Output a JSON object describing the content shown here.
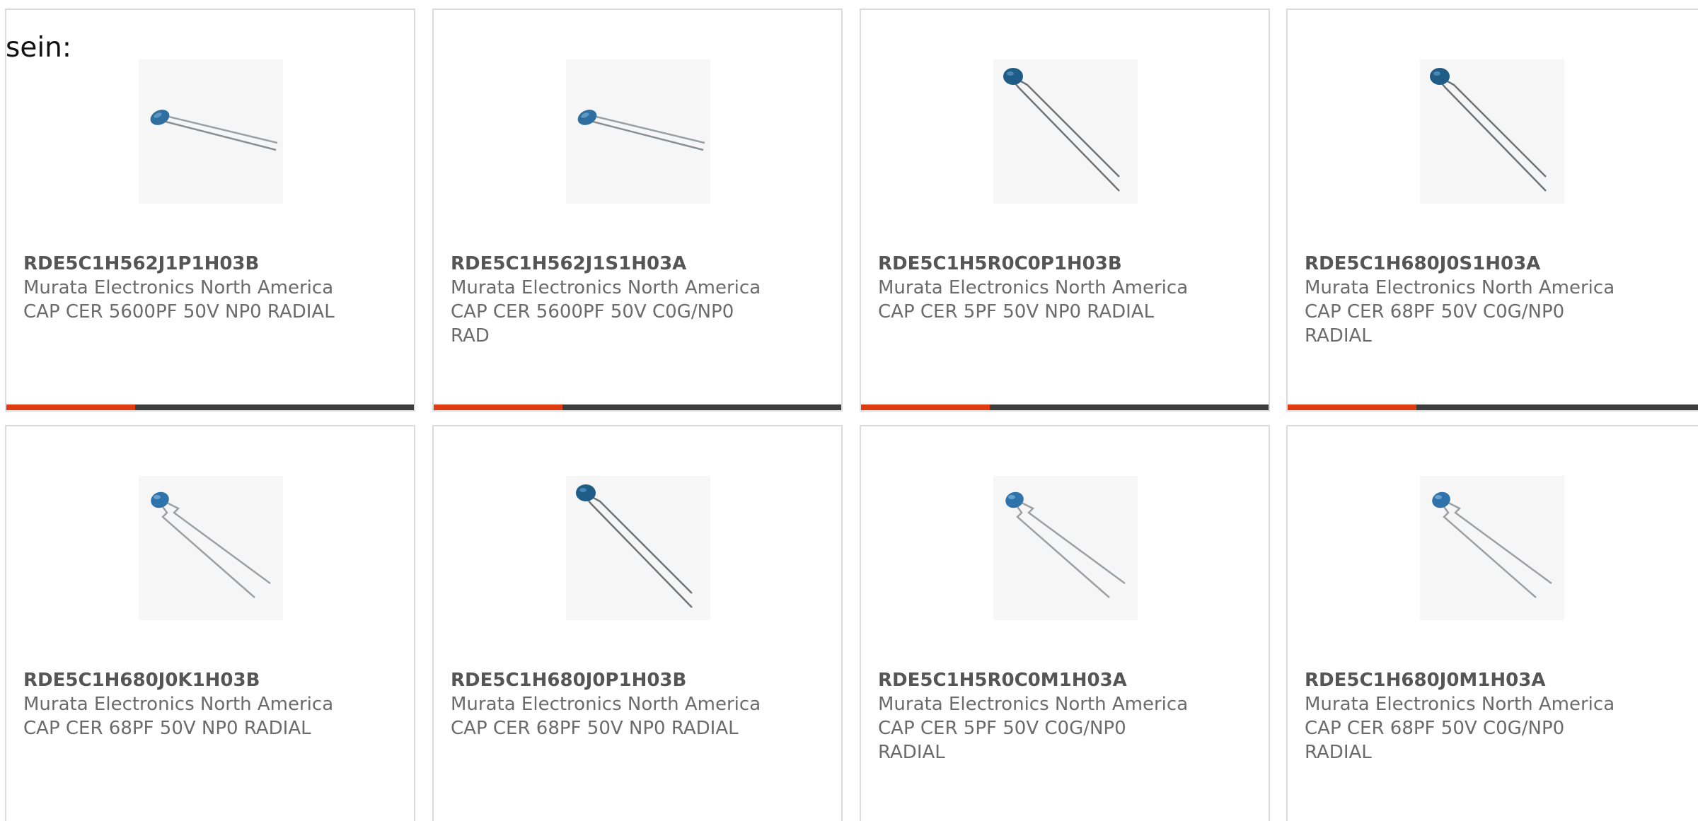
{
  "lead_text": "sein:",
  "colors": {
    "accent": "#e03c12",
    "bar_dark": "#3d3d3d",
    "card_border": "#dcdcdc",
    "capacitor_blue": "#2e6f9f",
    "lead_gray": "#8a8f93"
  },
  "products": [
    {
      "part_number": "RDE5C1H562J1P1H03B",
      "manufacturer": "Murata Electronics North America",
      "description": "CAP CER 5600PF 50V NP0 RADIAL",
      "image_icon": "capacitor-horizontal-image"
    },
    {
      "part_number": "RDE5C1H562J1S1H03A",
      "manufacturer": "Murata Electronics North America",
      "description": "CAP CER 5600PF 50V C0G/NP0 RAD",
      "image_icon": "capacitor-horizontal-image"
    },
    {
      "part_number": "RDE5C1H5R0C0P1H03B",
      "manufacturer": "Murata Electronics North America",
      "description": "CAP CER 5PF 50V NP0 RADIAL",
      "image_icon": "capacitor-diagonal-image"
    },
    {
      "part_number": "RDE5C1H680J0S1H03A",
      "manufacturer": "Murata Electronics North America",
      "description": "CAP CER 68PF 50V C0G/NP0 RADIAL",
      "image_icon": "capacitor-diagonal-image"
    },
    {
      "part_number": "RDE5C1H680J0K1H03B",
      "manufacturer": "Murata Electronics North America",
      "description": "CAP CER 68PF 50V NP0 RADIAL",
      "image_icon": "capacitor-kinked-leads-image"
    },
    {
      "part_number": "RDE5C1H680J0P1H03B",
      "manufacturer": "Murata Electronics North America",
      "description": "CAP CER 68PF 50V NP0 RADIAL",
      "image_icon": "capacitor-diagonal-image"
    },
    {
      "part_number": "RDE5C1H5R0C0M1H03A",
      "manufacturer": "Murata Electronics North America",
      "description": "CAP CER 5PF 50V C0G/NP0 RADIAL",
      "image_icon": "capacitor-kinked-leads-image"
    },
    {
      "part_number": "RDE5C1H680J0M1H03A",
      "manufacturer": "Murata Electronics North America",
      "description": "CAP CER 68PF 50V C0G/NP0 RADIAL",
      "image_icon": "capacitor-kinked-leads-image"
    }
  ]
}
